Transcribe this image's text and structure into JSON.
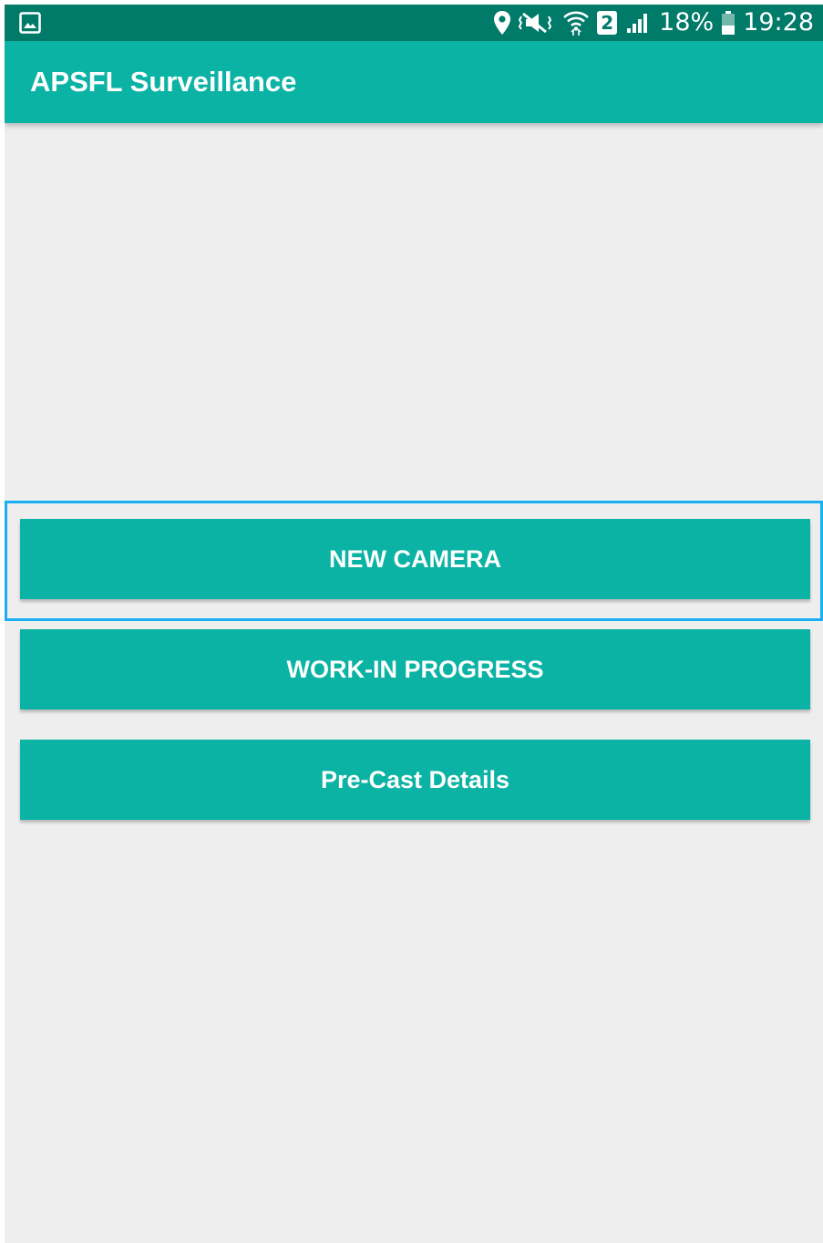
{
  "status_bar": {
    "left_icon": "gallery-image-icon",
    "icons": [
      "location-pin-icon",
      "vibrate-mute-icon",
      "wifi-icon",
      "sim-2-icon",
      "cell-signal-icon",
      "battery-icon"
    ],
    "sim_label": "2",
    "battery_percent": "18%",
    "battery_level": 0.18,
    "time": "19:28"
  },
  "app_bar": {
    "title": "APSFL Surveillance"
  },
  "buttons": {
    "new_camera": "NEW CAMERA",
    "work_in_progress": "WORK-IN PROGRESS",
    "pre_cast_details": "Pre-Cast Details"
  },
  "colors": {
    "status_bar": "#007a69",
    "primary": "#0ab3a3",
    "background": "#eeeeee",
    "focus_highlight": "#1aaef2",
    "text_on_primary": "#ffffff"
  }
}
